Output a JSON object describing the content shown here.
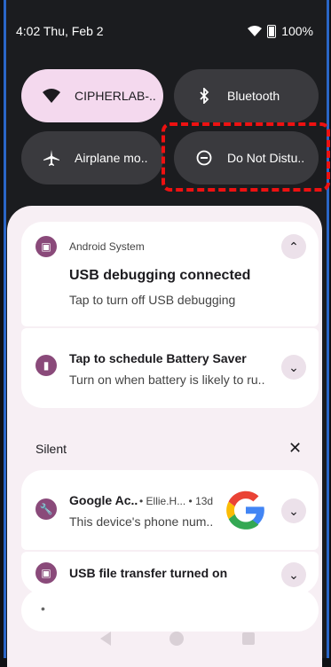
{
  "status_bar": {
    "time": "4:02 Thu, Feb 2",
    "battery": "100%",
    "wifi_badge": "5"
  },
  "quick_tiles": [
    {
      "label": "CIPHERLAB-..",
      "icon": "wifi-icon",
      "state": "on"
    },
    {
      "label": "Bluetooth",
      "icon": "bluetooth-icon",
      "state": "off"
    },
    {
      "label": "Airplane mo..",
      "icon": "airplane-icon",
      "state": "off"
    },
    {
      "label": "Do Not Distu..",
      "icon": "do-not-disturb-icon",
      "state": "off"
    }
  ],
  "notifications": {
    "android_system": {
      "app": "Android System",
      "title": "USB debugging connected",
      "body": "Tap to turn off USB debugging"
    },
    "battery_saver": {
      "title": "Tap to schedule Battery Saver",
      "body": "Turn on when battery is likely to ru.."
    },
    "silent_label": "Silent",
    "google": {
      "title": "Google Ac..",
      "meta": "• Ellie.H... • 13d",
      "body": "This device's phone num.."
    },
    "usb_transfer": {
      "title": "USB file transfer turned on"
    },
    "bottom_dot": "•"
  },
  "colors": {
    "tile_on": "#f4d9ee",
    "tile_off": "#3a3a3e",
    "shade": "#f7eff4",
    "highlight": "#ee1111"
  }
}
